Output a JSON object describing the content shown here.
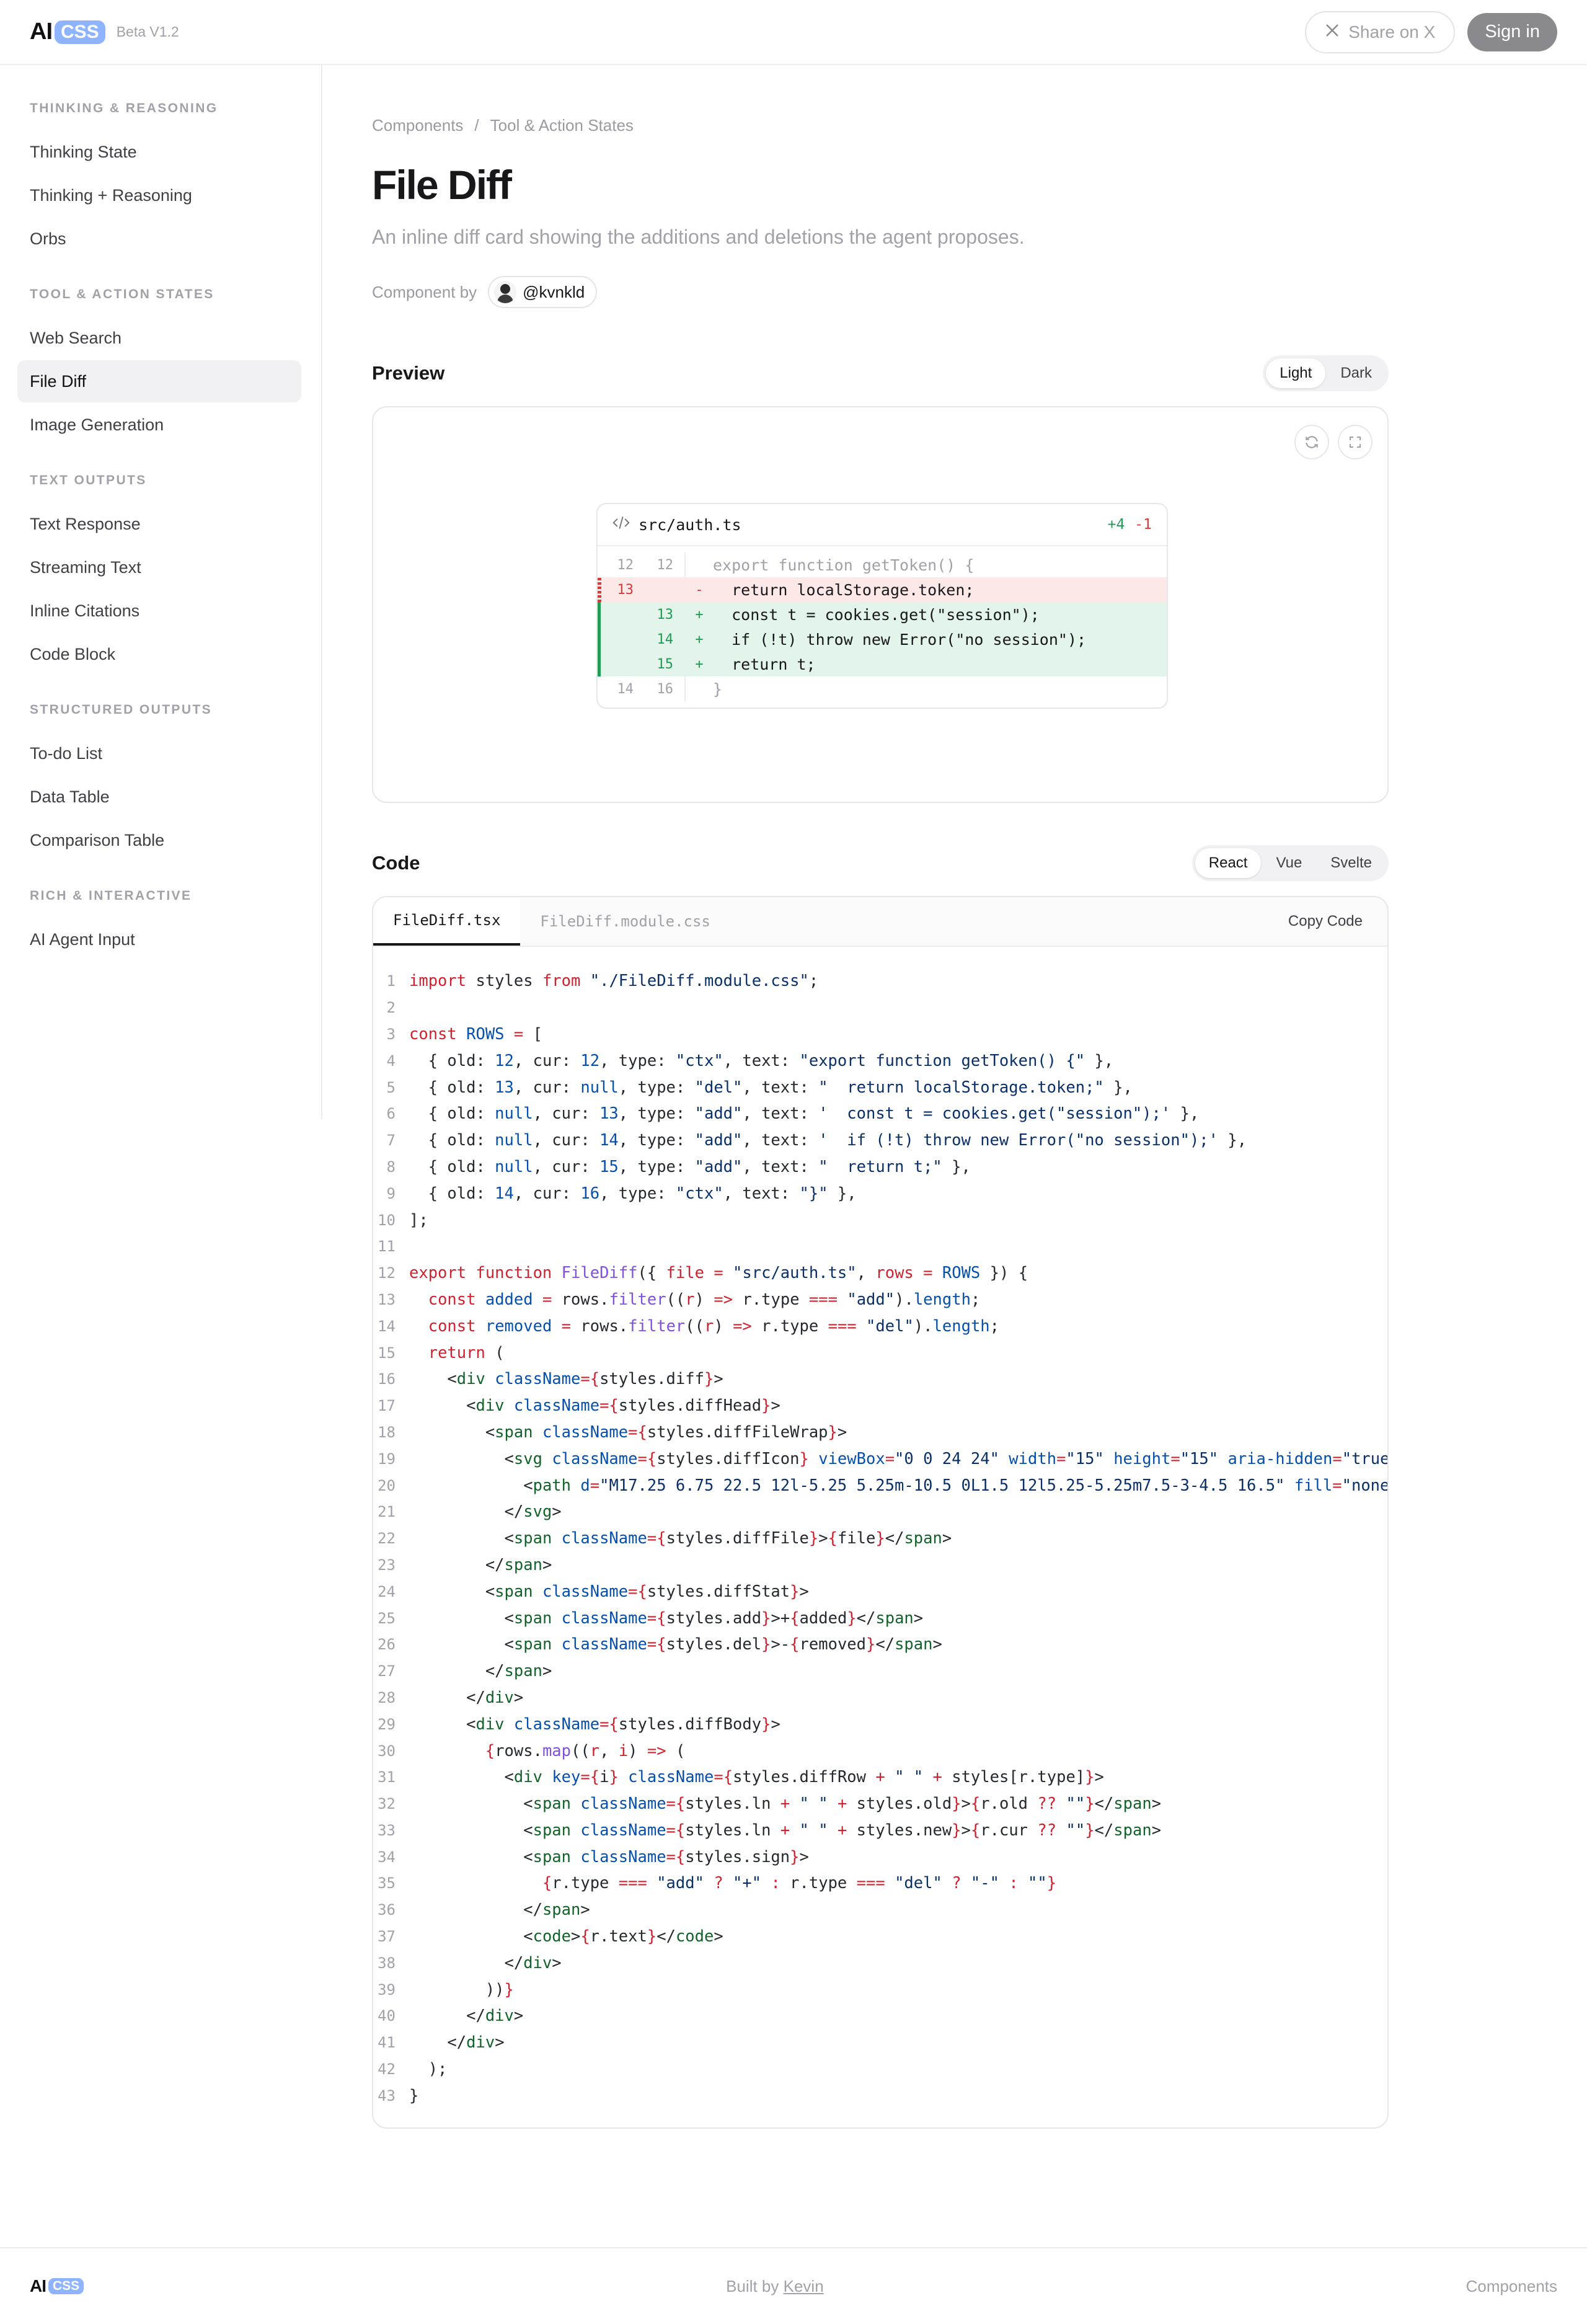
{
  "header": {
    "logo_ai": "AI",
    "logo_css": "CSS",
    "beta": "Beta V1.2",
    "share": "Share on X",
    "signin": "Sign in"
  },
  "sidebar": {
    "groups": [
      {
        "title": "THINKING & REASONING",
        "items": [
          "Thinking State",
          "Thinking + Reasoning",
          "Orbs"
        ]
      },
      {
        "title": "TOOL & ACTION STATES",
        "items": [
          "Web Search",
          "File Diff",
          "Image Generation"
        ]
      },
      {
        "title": "TEXT OUTPUTS",
        "items": [
          "Text Response",
          "Streaming Text",
          "Inline Citations",
          "Code Block"
        ]
      },
      {
        "title": "STRUCTURED OUTPUTS",
        "items": [
          "To-do List",
          "Data Table",
          "Comparison Table"
        ]
      },
      {
        "title": "RICH & INTERACTIVE",
        "items": [
          "AI Agent Input"
        ]
      }
    ],
    "active": "File Diff"
  },
  "main": {
    "breadcrumb": [
      "Components",
      "/",
      "Tool & Action States"
    ],
    "title": "File Diff",
    "subtitle": "An inline diff card showing the additions and deletions the agent proposes.",
    "by_label": "Component by",
    "author": "@kvnkld"
  },
  "preview": {
    "title": "Preview",
    "themes": [
      "Light",
      "Dark"
    ],
    "active_theme": "Light",
    "diff": {
      "file": "src/auth.ts",
      "added": "+4",
      "removed": "-1",
      "rows": [
        {
          "old": "12",
          "cur": "12",
          "type": "ctx",
          "sign": "",
          "text": "export function getToken() {"
        },
        {
          "old": "13",
          "cur": "",
          "type": "del",
          "sign": "-",
          "text": "  return localStorage.token;"
        },
        {
          "old": "",
          "cur": "13",
          "type": "add",
          "sign": "+",
          "text": "  const t = cookies.get(\"session\");"
        },
        {
          "old": "",
          "cur": "14",
          "type": "add",
          "sign": "+",
          "text": "  if (!t) throw new Error(\"no session\");"
        },
        {
          "old": "",
          "cur": "15",
          "type": "add",
          "sign": "+",
          "text": "  return t;"
        },
        {
          "old": "14",
          "cur": "16",
          "type": "ctx",
          "sign": "",
          "text": "}"
        }
      ]
    }
  },
  "code": {
    "title": "Code",
    "frameworks": [
      "React",
      "Vue",
      "Svelte"
    ],
    "active_framework": "React",
    "tabs": [
      "FileDiff.tsx",
      "FileDiff.module.css"
    ],
    "copy": "Copy Code"
  },
  "footer": {
    "built_by": "Built by",
    "author": "Kevin",
    "link": "Components"
  }
}
